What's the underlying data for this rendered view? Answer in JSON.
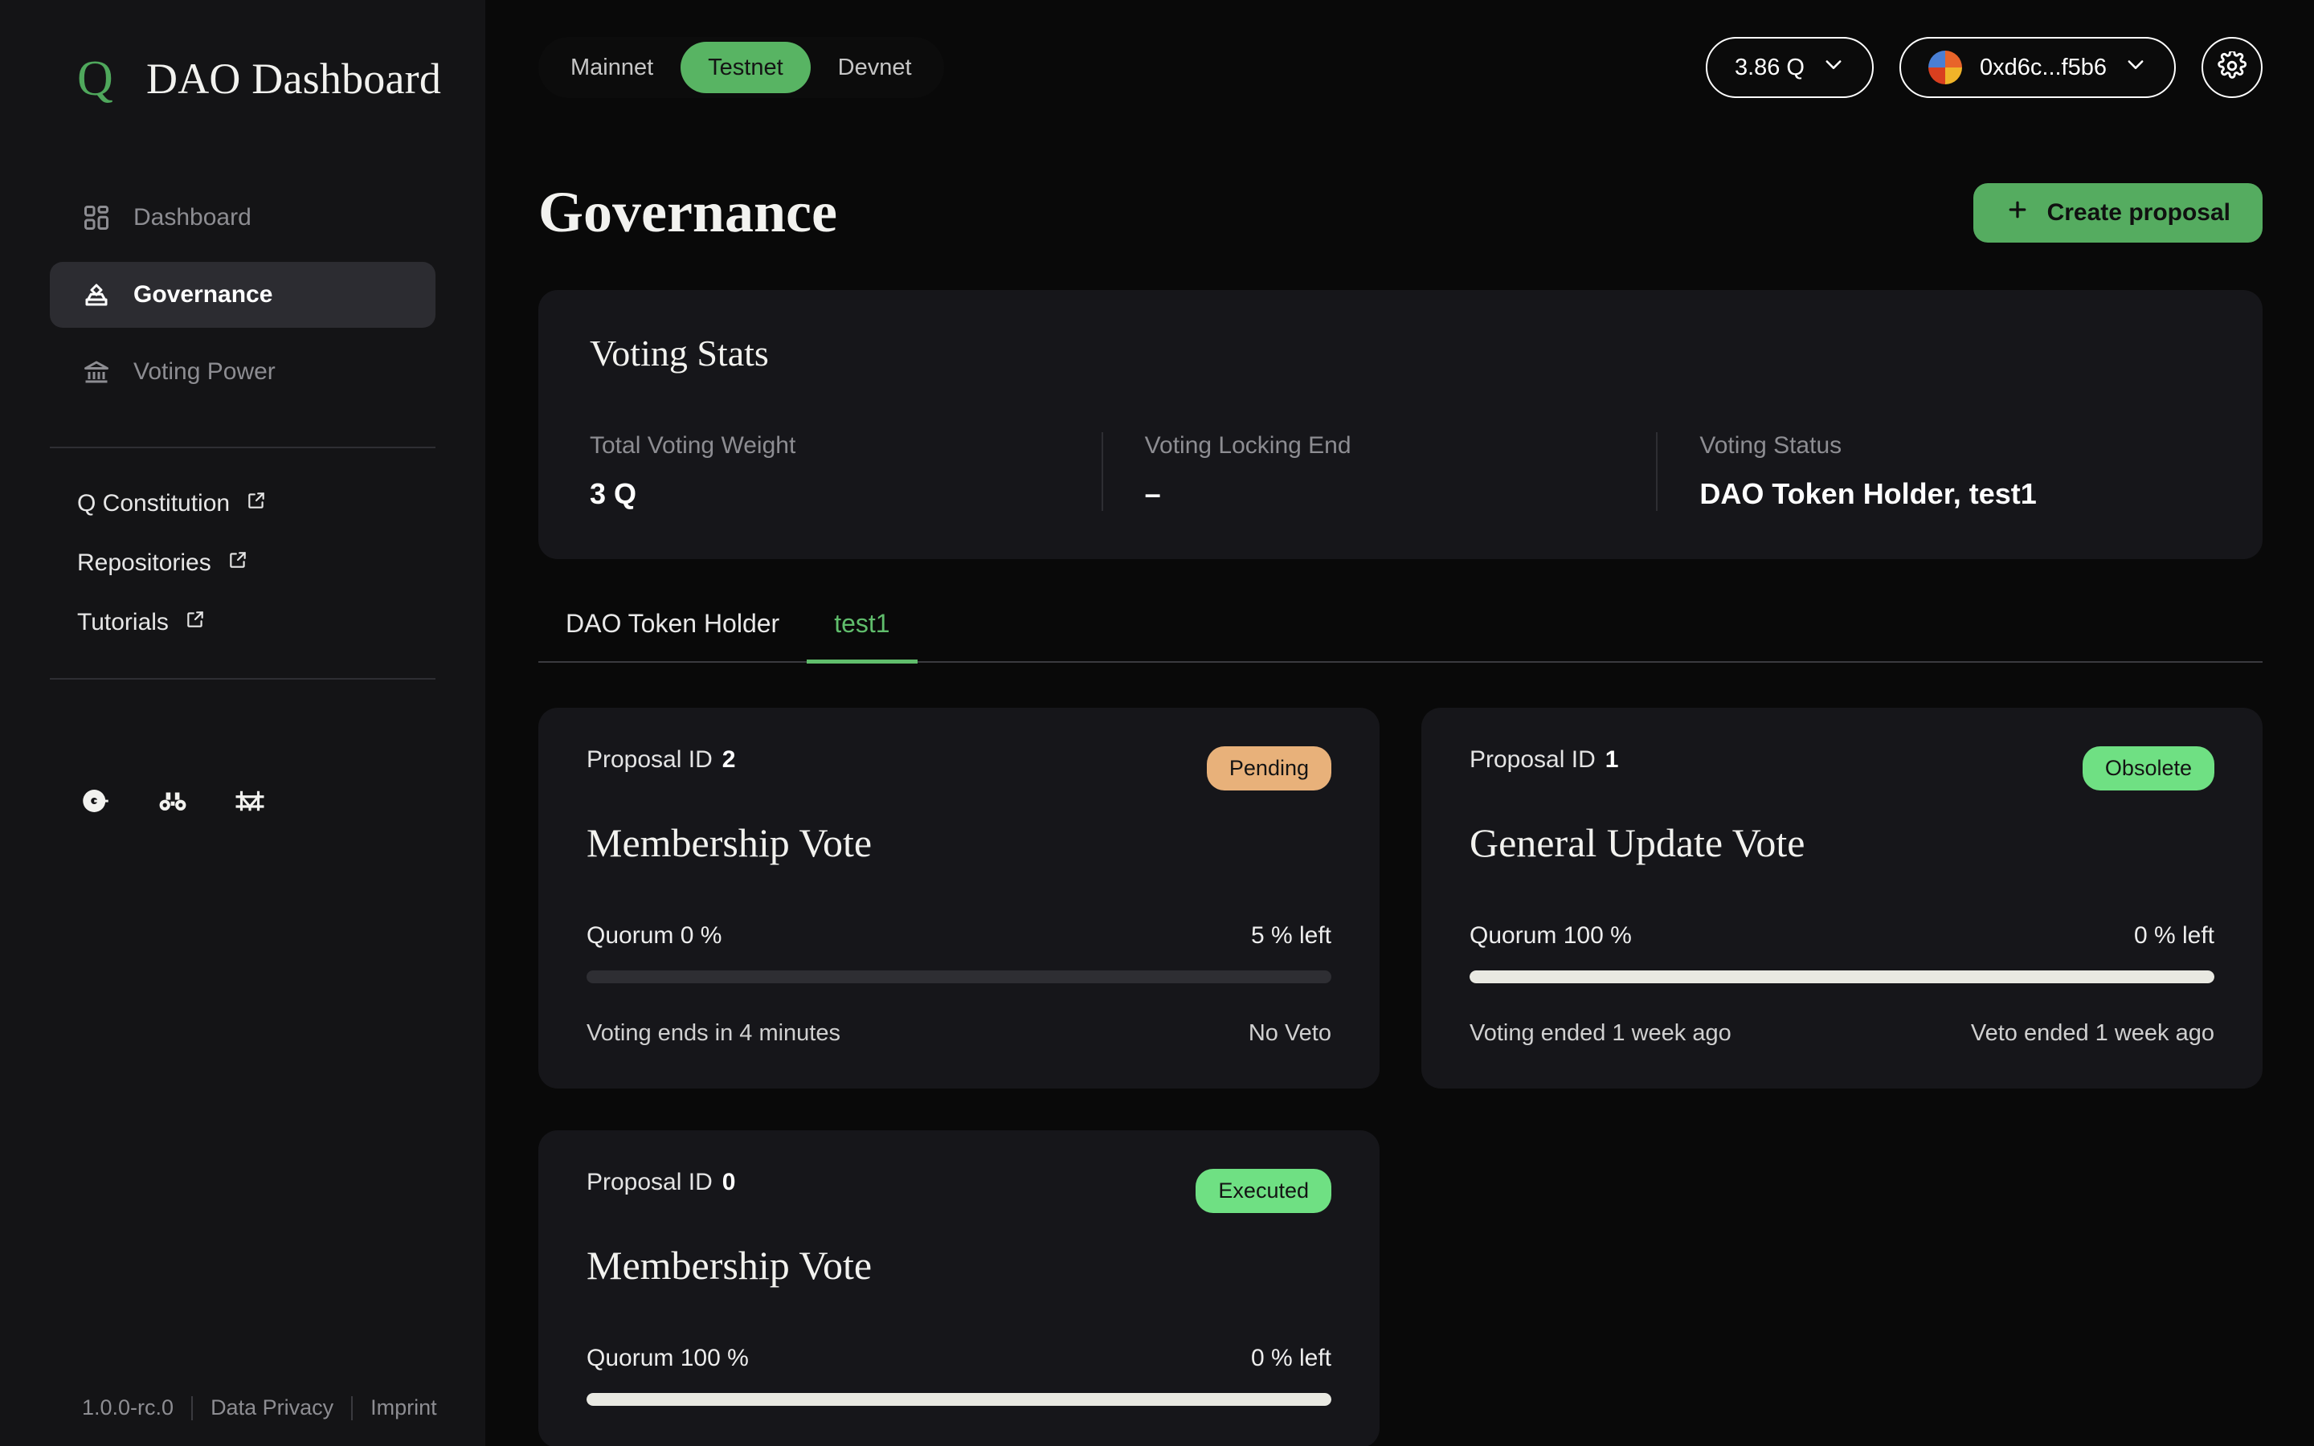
{
  "brand": {
    "logo_letter": "Q",
    "title": "DAO Dashboard"
  },
  "sidebar": {
    "nav": [
      {
        "label": "Dashboard",
        "icon": "grid-icon",
        "active": false
      },
      {
        "label": "Governance",
        "icon": "ballot-box-icon",
        "active": true
      },
      {
        "label": "Voting Power",
        "icon": "bank-icon",
        "active": false
      }
    ],
    "links": [
      {
        "label": "Q Constitution",
        "icon": "external-link-icon"
      },
      {
        "label": "Repositories",
        "icon": "external-link-icon"
      },
      {
        "label": "Tutorials",
        "icon": "external-link-icon"
      }
    ],
    "socials": [
      {
        "name": "faucet-icon"
      },
      {
        "name": "binoculars-explorer-icon"
      },
      {
        "name": "bridge-icon"
      }
    ]
  },
  "footer": {
    "version": "1.0.0-rc.0",
    "data_privacy": "Data Privacy",
    "imprint": "Imprint"
  },
  "topbar": {
    "networks": [
      {
        "label": "Mainnet",
        "active": false
      },
      {
        "label": "Testnet",
        "active": true
      },
      {
        "label": "Devnet",
        "active": false
      }
    ],
    "balance": "3.86 Q",
    "account": "0xd6c...f5b6",
    "settings_icon": "gear-icon",
    "chevron_icon": "chevron-down-icon",
    "avatar_colors": [
      "#4a7fd4",
      "#e8642a",
      "#d93f1f",
      "#f0b429"
    ]
  },
  "page": {
    "title": "Governance",
    "create_button": {
      "label": "Create proposal",
      "icon": "plus-icon"
    }
  },
  "voting_stats": {
    "title": "Voting Stats",
    "items": [
      {
        "label": "Total Voting Weight",
        "value": "3 Q"
      },
      {
        "label": "Voting Locking End",
        "value": "–"
      },
      {
        "label": "Voting Status",
        "value": "DAO Token Holder, test1"
      }
    ]
  },
  "tabs": [
    {
      "label": "DAO Token Holder",
      "active": false
    },
    {
      "label": "test1",
      "active": true
    }
  ],
  "proposals": [
    {
      "id_label": "Proposal ID",
      "id": "2",
      "status": "Pending",
      "status_kind": "pending",
      "title": "Membership Vote",
      "quorum_label": "Quorum 0 %",
      "quorum_pct": 0,
      "left_label": "5 % left",
      "voting_info": "Voting ends in 4 minutes",
      "veto_info": "No Veto"
    },
    {
      "id_label": "Proposal ID",
      "id": "1",
      "status": "Obsolete",
      "status_kind": "obsolete",
      "title": "General Update Vote",
      "quorum_label": "Quorum 100 %",
      "quorum_pct": 100,
      "left_label": "0 % left",
      "voting_info": "Voting ended 1 week ago",
      "veto_info": "Veto ended 1 week ago"
    },
    {
      "id_label": "Proposal ID",
      "id": "0",
      "status": "Executed",
      "status_kind": "executed",
      "title": "Membership Vote",
      "quorum_label": "Quorum 100 %",
      "quorum_pct": 100,
      "left_label": "0 % left",
      "voting_info": "",
      "veto_info": ""
    }
  ],
  "colors": {
    "accent_green": "#58b463",
    "badge_green": "#6fe083",
    "badge_orange": "#e8b17a",
    "card_bg": "#16161a",
    "sidebar_bg": "#141416",
    "page_bg": "#090909"
  }
}
